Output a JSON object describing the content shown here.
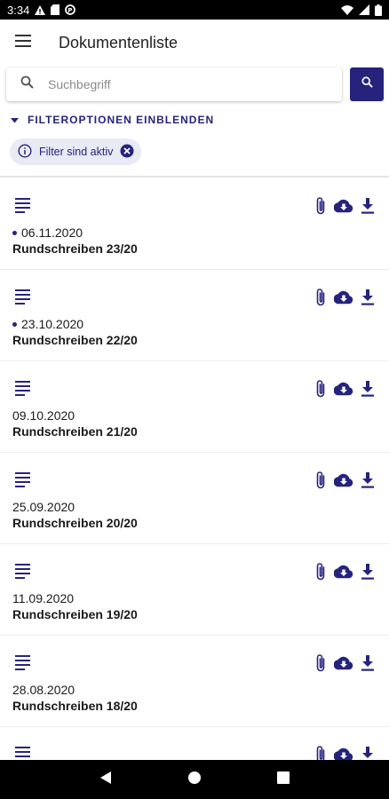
{
  "statusbar": {
    "time": "3:34"
  },
  "appbar": {
    "title": "Dokumentenliste"
  },
  "search": {
    "placeholder": "Suchbegriff"
  },
  "filters": {
    "toggle_label": "FILTEROPTIONEN EINBLENDEN",
    "active_chip": "Filter sind aktiv"
  },
  "documents": [
    {
      "date": "06.11.2020",
      "title": "Rundschreiben 23/20",
      "new": true
    },
    {
      "date": "23.10.2020",
      "title": "Rundschreiben 22/20",
      "new": true
    },
    {
      "date": "09.10.2020",
      "title": "Rundschreiben 21/20",
      "new": false
    },
    {
      "date": "25.09.2020",
      "title": "Rundschreiben 20/20",
      "new": false
    },
    {
      "date": "11.09.2020",
      "title": "Rundschreiben 19/20",
      "new": false
    },
    {
      "date": "28.08.2020",
      "title": "Rundschreiben 18/20",
      "new": false
    },
    {
      "date": "",
      "title": "",
      "new": false
    }
  ],
  "icons": {
    "menu": "menu-icon",
    "search": "search-icon",
    "expand": "chevron-down-icon",
    "info": "info-icon",
    "clear": "close-circle-icon",
    "document": "text-document-icon",
    "attachment": "paperclip-icon",
    "cloud": "cloud-download-icon",
    "download": "download-icon"
  },
  "colors": {
    "primary": "#26237d",
    "chip_bg": "#e8eaf4",
    "background": "#ffffff"
  }
}
